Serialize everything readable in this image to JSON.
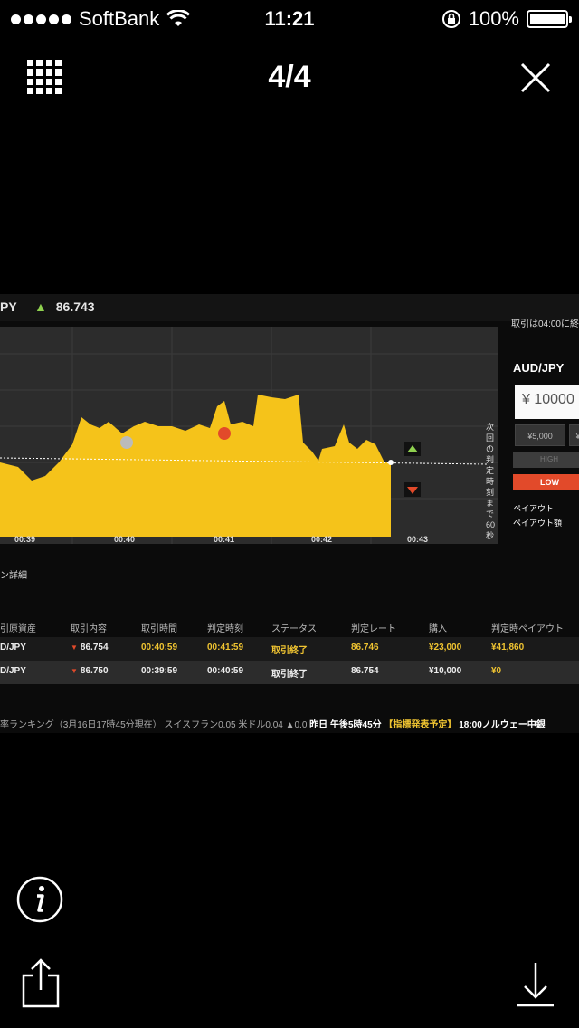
{
  "status_bar": {
    "carrier": "SoftBank",
    "time": "11:21",
    "battery": "100%",
    "battery_level": 1.0
  },
  "viewer": {
    "counter": "4/4"
  },
  "photo": {
    "symbol_partial": "PY",
    "current_price": "86.743",
    "trade_end_notice": "取引は04:00に終",
    "time_ticks": [
      "00:39",
      "00:40",
      "00:41",
      "00:42",
      "00:43"
    ],
    "countdown_vertical": "次回の判定時刻まで60秒",
    "side_panel": {
      "pair": "AUD/JPY",
      "amount": "¥ 10000",
      "presets": [
        "¥5,000",
        "¥"
      ],
      "high_label": "HIGH",
      "low_label": "LOW",
      "payout_label": "ペイアウト",
      "payout_amount_label": "ペイアウト額"
    },
    "section_title": "ン詳細",
    "table": {
      "headers": [
        "引原資産",
        "取引内容",
        "取引時間",
        "判定時刻",
        "ステータス",
        "判定レート",
        "購入",
        "判定時ペイアウト"
      ],
      "rows": [
        [
          "D/JPY",
          "86.754",
          "00:40:59",
          "00:41:59",
          "取引終了",
          "86.746",
          "¥23,000",
          "¥41,860"
        ],
        [
          "D/JPY",
          "86.750",
          "00:39:59",
          "00:40:59",
          "取引終了",
          "86.754",
          "¥10,000",
          "¥0"
        ]
      ]
    },
    "ticker": {
      "part1": "率ランキング（3月16日17時45分現在） スイスフラン0.05 米ドル0.04 ▲0.0",
      "part2": "昨日 午後5時45分",
      "part3": "【指標発表予定】",
      "part4": "18:00ノルウェー中銀"
    },
    "colors": {
      "chart_fill": "#f5c31a",
      "up": "#8fd14f",
      "down": "#e24a2a"
    }
  }
}
